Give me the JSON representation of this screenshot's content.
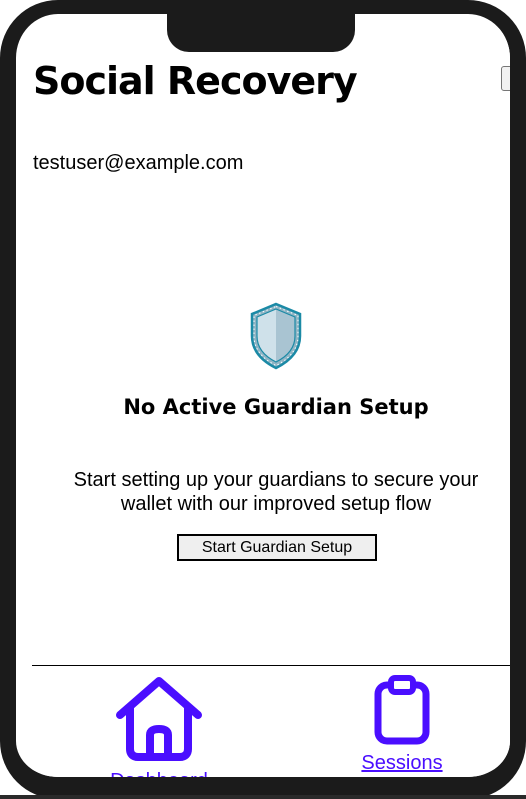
{
  "header": {
    "title": "Social Recovery",
    "menu_icon": "menu-box-icon"
  },
  "user": {
    "email": "testuser@example.com"
  },
  "empty_state": {
    "icon": "shield-icon",
    "title": "No Active Guardian Setup",
    "description": "Start setting up your guardians to secure your wallet with our improved setup flow",
    "button_label": "Start Guardian Setup"
  },
  "bottom_nav": {
    "items": [
      {
        "label": "Dashboard",
        "icon": "home-icon"
      },
      {
        "label": "Sessions",
        "icon": "clipboard-icon"
      }
    ]
  },
  "colors": {
    "nav_accent": "#4a0eff",
    "frame": "#1b1b1b",
    "shield_fill": "#b7d0dc",
    "shield_border": "#1b8aa6"
  }
}
